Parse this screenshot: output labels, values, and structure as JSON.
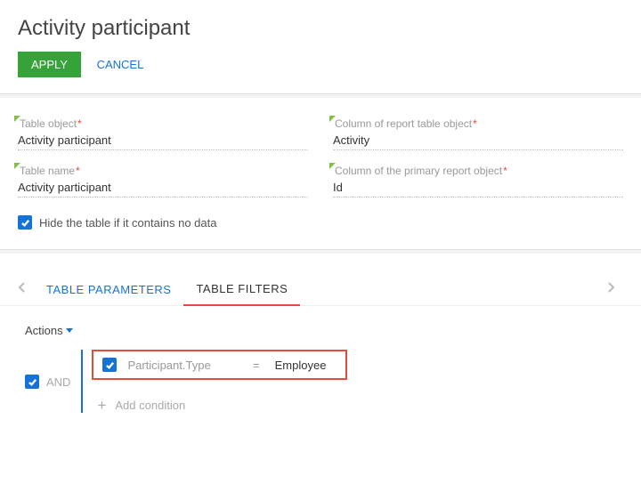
{
  "title": "Activity participant",
  "buttons": {
    "apply": "APPLY",
    "cancel": "CANCEL"
  },
  "fields": {
    "table_object": {
      "label": "Table object",
      "value": "Activity participant"
    },
    "column_report": {
      "label": "Column of report table object",
      "value": "Activity"
    },
    "table_name": {
      "label": "Table name",
      "value": "Activity participant"
    },
    "column_primary": {
      "label": "Column of the primary report object",
      "value": "Id"
    }
  },
  "hide_empty_label": "Hide the table if it contains no data",
  "hide_empty_checked": true,
  "tabs": {
    "parameters": "TABLE PARAMETERS",
    "filters": "TABLE FILTERS"
  },
  "filters": {
    "actions_label": "Actions",
    "root_op": "AND",
    "condition": {
      "field": "Participant.Type",
      "op": "=",
      "value": "Employee"
    },
    "add_label": "Add condition"
  }
}
